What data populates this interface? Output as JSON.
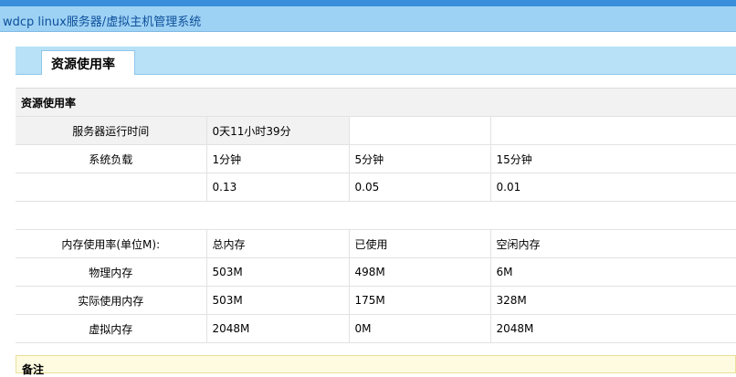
{
  "window": {
    "title": "wdcp linux服务器/虚拟主机管理系统"
  },
  "tab": {
    "label": "资源使用率"
  },
  "section": {
    "title": "资源使用率"
  },
  "uptime": {
    "label": "服务器运行时间",
    "value": "0天11小时39分"
  },
  "load": {
    "label": "系统负载",
    "headers": [
      "1分钟",
      "5分钟",
      "15分钟"
    ],
    "values": [
      "0.13",
      "0.05",
      "0.01"
    ]
  },
  "memory": {
    "label": "内存使用率(单位M):",
    "headers": [
      "总内存",
      "已使用",
      "空闲内存"
    ],
    "rows": [
      {
        "label": "物理内存",
        "values": [
          "503M",
          "498M",
          "6M"
        ]
      },
      {
        "label": "实际使用内存",
        "values": [
          "503M",
          "175M",
          "328M"
        ]
      },
      {
        "label": "虚拟内存",
        "values": [
          "2048M",
          "0M",
          "2048M"
        ]
      }
    ]
  },
  "note": {
    "label": "备注"
  }
}
